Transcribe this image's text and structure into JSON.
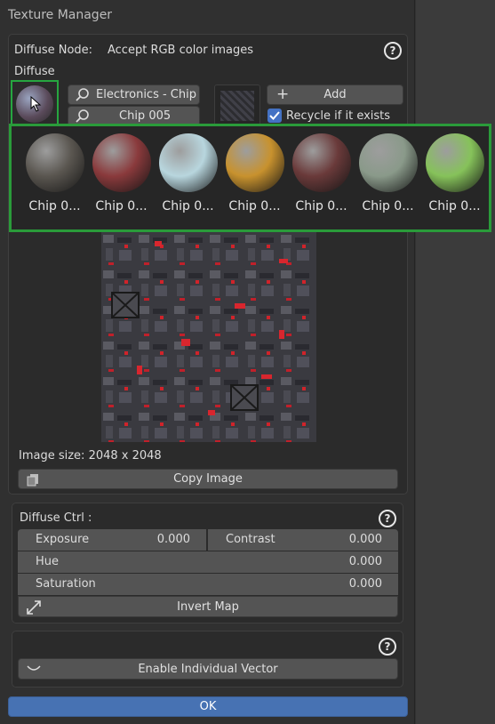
{
  "window": {
    "title": "Texture Manager"
  },
  "diffuse_node": {
    "label": "Diffuse Node:",
    "description": "Accept RGB color images",
    "section_label": "Diffuse"
  },
  "library": {
    "category": "Electronics - Chip",
    "texture": "Chip 005",
    "add_label": "Add",
    "recycle_label": "Recycle if it exists",
    "recycle_checked": true
  },
  "gallery": {
    "items": [
      {
        "label": "Chip 0...",
        "color": "#5a5650"
      },
      {
        "label": "Chip 0...",
        "color": "#8a3a3c"
      },
      {
        "label": "Chip 0...",
        "color": "#b8d6de"
      },
      {
        "label": "Chip 0...",
        "color": "#c8922e"
      },
      {
        "label": "Chip 0...",
        "color": "#6a3a3a"
      },
      {
        "label": "Chip 0...",
        "color": "#8a9a8a"
      },
      {
        "label": "Chip 0...",
        "color": "#86c25a"
      }
    ]
  },
  "image": {
    "size_label": "Image size: 2048 x 2048",
    "copy_label": "Copy Image"
  },
  "diffuse_ctrl": {
    "header": "Diffuse Ctrl :",
    "exposure": {
      "label": "Exposure",
      "value": "0.000"
    },
    "contrast": {
      "label": "Contrast",
      "value": "0.000"
    },
    "hue": {
      "label": "Hue",
      "value": "0.000"
    },
    "saturation": {
      "label": "Saturation",
      "value": "0.000"
    },
    "invert_label": "Invert Map"
  },
  "vector": {
    "enable_label": "Enable Individual Vector"
  },
  "footer": {
    "ok_label": "OK"
  }
}
